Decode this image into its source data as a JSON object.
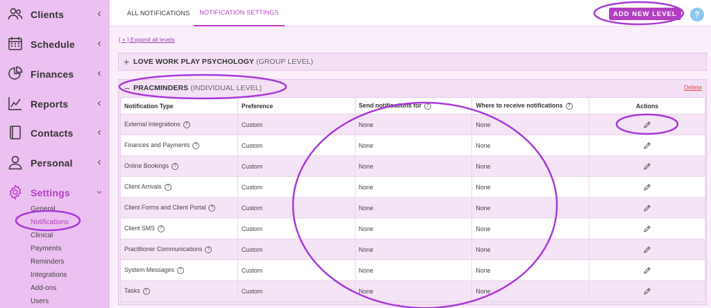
{
  "sidebar": {
    "items": [
      {
        "label": "Clients",
        "icon": "users-icon"
      },
      {
        "label": "Schedule",
        "icon": "calendar-icon"
      },
      {
        "label": "Finances",
        "icon": "pie-chart-icon"
      },
      {
        "label": "Reports",
        "icon": "line-chart-icon"
      },
      {
        "label": "Contacts",
        "icon": "address-book-icon"
      },
      {
        "label": "Personal",
        "icon": "person-icon"
      },
      {
        "label": "Settings",
        "icon": "gear-icon"
      }
    ],
    "settings_sub": [
      "General",
      "Notifications",
      "Clinical",
      "Payments",
      "Reminders",
      "Integrations",
      "Add-ons",
      "Users"
    ]
  },
  "tabs": [
    {
      "label": "ALL NOTIFICATIONS"
    },
    {
      "label": "NOTIFICATION SETTINGS"
    }
  ],
  "toolbar": {
    "add_label": "ADD NEW LEVEL",
    "help_label": "?"
  },
  "expand_link": "[ + ] Expand all levels",
  "group_level": {
    "toggle": "+",
    "name": "LOVE WORK PLAY PSYCHOLOGY",
    "tag": "(GROUP LEVEL)"
  },
  "individual_level": {
    "toggle": "−",
    "name": "PRACMINDERS",
    "tag": "(INDIVIDUAL LEVEL)",
    "delete_label": "Delete"
  },
  "table": {
    "headers": [
      "Notification Type",
      "Preference",
      "Send notifications for",
      "Where to receive notifications",
      "Actions"
    ],
    "help_glyph": "?",
    "rows": [
      {
        "type": "External Integrations",
        "preference": "Custom",
        "send_for": "None",
        "where": "None"
      },
      {
        "type": "Finances and Payments",
        "preference": "Custom",
        "send_for": "None",
        "where": "None"
      },
      {
        "type": "Online Bookings",
        "preference": "Custom",
        "send_for": "None",
        "where": "None"
      },
      {
        "type": "Client Arrivals",
        "preference": "Custom",
        "send_for": "None",
        "where": "None"
      },
      {
        "type": "Client Forms and Client Portal",
        "preference": "Custom",
        "send_for": "None",
        "where": "None"
      },
      {
        "type": "Client SMS",
        "preference": "Custom",
        "send_for": "None",
        "where": "None"
      },
      {
        "type": "Practitioner Communications",
        "preference": "Custom",
        "send_for": "None",
        "where": "None"
      },
      {
        "type": "System Messages",
        "preference": "Custom",
        "send_for": "None",
        "where": "None"
      },
      {
        "type": "Tasks",
        "preference": "Custom",
        "send_for": "None",
        "where": "None"
      }
    ]
  },
  "colors": {
    "accent": "#b23fc0",
    "annotation": "#a838d8",
    "sidebar_bg": "#ecc0f0",
    "delete": "#e05050",
    "help": "#8cc8f0"
  }
}
